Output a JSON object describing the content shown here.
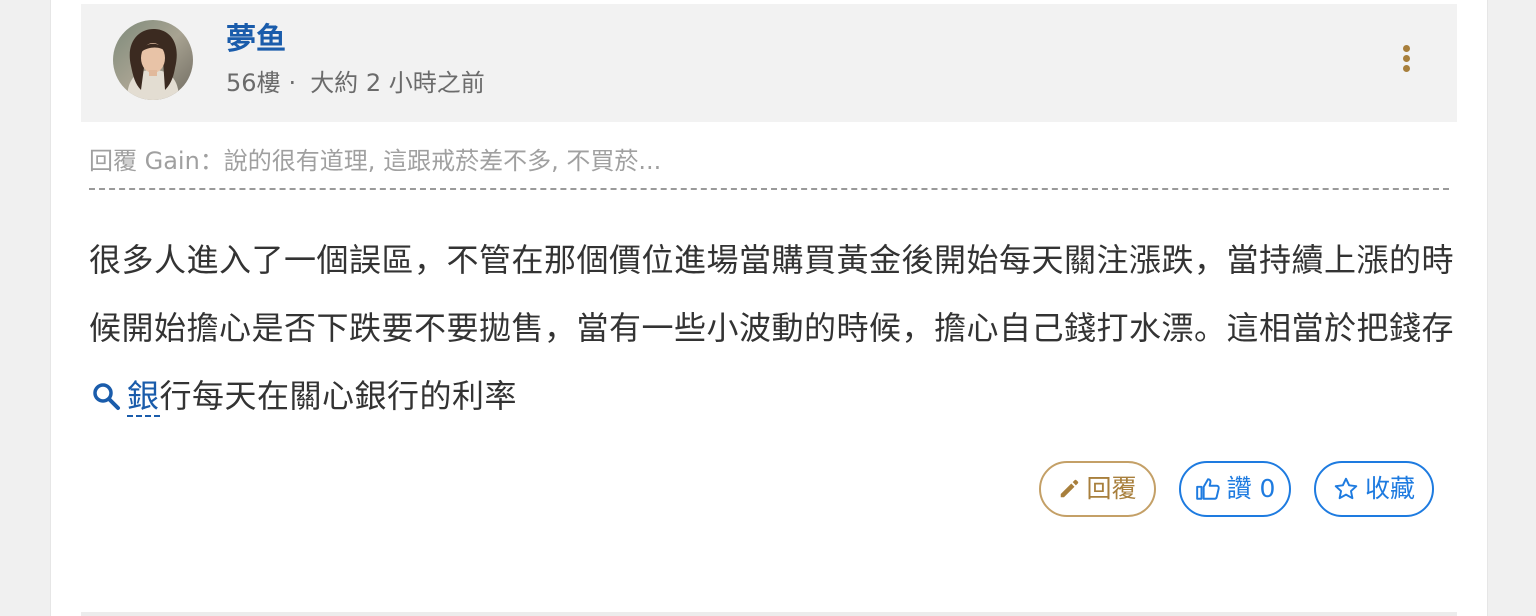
{
  "author": {
    "name": "夢鱼",
    "floor": "56樓",
    "separator": "·",
    "time": "大約 2 小時之前",
    "avatar_icon": "user-avatar-photo"
  },
  "header": {
    "menu_icon": "more-vertical-icon"
  },
  "reply_quote": {
    "prefix": "回覆 Gain",
    "text": "：說的很有道理, 這跟戒菸差不多, 不買菸..."
  },
  "body": {
    "text_before": "很多人進入了一個誤區，不管在那個價位進場當購買黃金後開始每天關注漲跌，當持續上漲的時候開始擔心是否下跌要不要拋售，當有一些小波動的時候，擔心自己錢打水漂。這相當於把錢存",
    "keyword_icon": "search-icon",
    "keyword": "銀",
    "text_after": "行每天在關心銀行的利率"
  },
  "actions": {
    "reply_label": "回覆",
    "reply_icon": "pencil-icon",
    "like_label": "讚 0",
    "like_icon": "thumbs-up-icon",
    "favorite_label": "收藏",
    "favorite_icon": "star-icon"
  },
  "colors": {
    "link_blue": "#1a5cab",
    "button_blue": "#1e7be0",
    "gold": "#a87f3c"
  }
}
